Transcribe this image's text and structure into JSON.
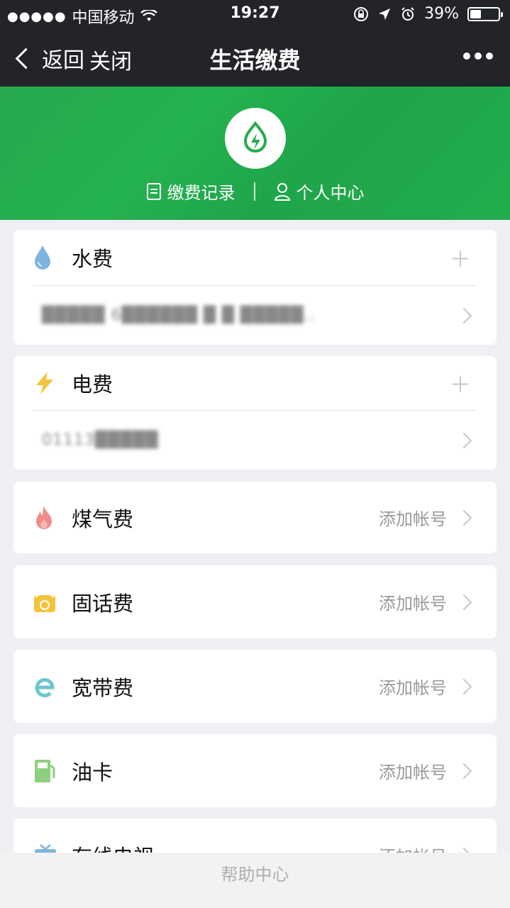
{
  "status_bar": {
    "carrier": "中国移动",
    "time": "19:27",
    "battery": "39%",
    "battery_level": 0.39
  },
  "nav": {
    "back_label": "返回",
    "close_label": "关闭",
    "title": "生活缴费"
  },
  "hero": {
    "record_label": "缴费记录",
    "profile_label": "个人中心"
  },
  "bills": [
    {
      "label": "水费",
      "account": "█████ 6██████ █ █ █████.."
    },
    {
      "label": "电费",
      "account": "01113█████"
    },
    {
      "label": "煤气费",
      "hint": "添加帐号"
    },
    {
      "label": "固话费",
      "hint": "添加帐号"
    },
    {
      "label": "宽带费",
      "hint": "添加帐号"
    },
    {
      "label": "油卡",
      "hint": "添加帐号"
    },
    {
      "label": "有线电视",
      "hint": "添加帐号"
    }
  ],
  "footer": {
    "help_label": "帮助中心"
  },
  "colors": {
    "accent_green": "#22ad4c",
    "nav_bg": "#222428"
  }
}
